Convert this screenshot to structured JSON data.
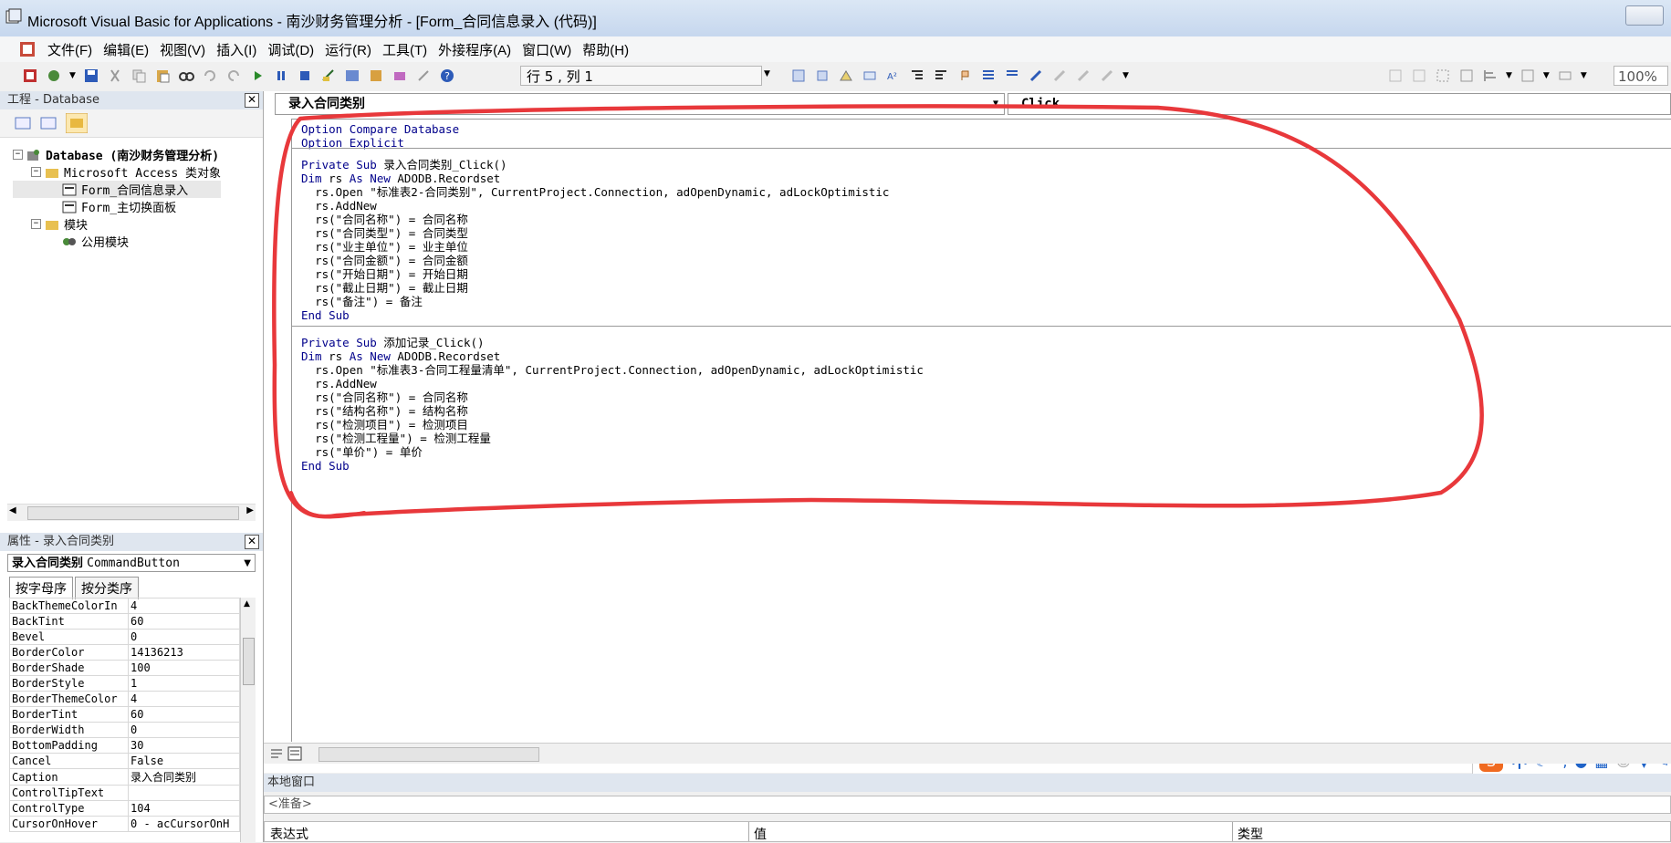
{
  "window": {
    "title": "Microsoft Visual Basic for Applications - 南沙财务管理分析 - [Form_合同信息录入 (代码)]"
  },
  "menu": [
    {
      "label": "文件(F)"
    },
    {
      "label": "编辑(E)"
    },
    {
      "label": "视图(V)"
    },
    {
      "label": "插入(I)"
    },
    {
      "label": "调试(D)"
    },
    {
      "label": "运行(R)"
    },
    {
      "label": "工具(T)"
    },
    {
      "label": "外接程序(A)"
    },
    {
      "label": "窗口(W)"
    },
    {
      "label": "帮助(H)"
    }
  ],
  "toolbar": {
    "cursor_position": "行 5 , 列 1",
    "zoom": "100%"
  },
  "project_pane": {
    "title": "工程 - Database",
    "close": "✕",
    "tree": {
      "root": "Database (南沙财务管理分析)",
      "group1": "Microsoft Access 类对象",
      "item1": "Form_合同信息录入",
      "item2": "Form_主切换面板",
      "group2": "模块",
      "item3": "公用模块"
    }
  },
  "properties_pane": {
    "title": "属性 - 录入合同类别",
    "close": "✕",
    "object_name": "录入合同类别",
    "object_type": "CommandButton",
    "tabs": [
      "按字母序",
      "按分类序"
    ],
    "rows": [
      {
        "name": "BackThemeColorIn",
        "value": "4"
      },
      {
        "name": "BackTint",
        "value": "60"
      },
      {
        "name": "Bevel",
        "value": "0"
      },
      {
        "name": "BorderColor",
        "value": "14136213"
      },
      {
        "name": "BorderShade",
        "value": "100"
      },
      {
        "name": "BorderStyle",
        "value": "1"
      },
      {
        "name": "BorderThemeColor",
        "value": "4"
      },
      {
        "name": "BorderTint",
        "value": "60"
      },
      {
        "name": "BorderWidth",
        "value": "0"
      },
      {
        "name": "BottomPadding",
        "value": "30"
      },
      {
        "name": "Cancel",
        "value": "False"
      },
      {
        "name": "Caption",
        "value": "录入合同类别"
      },
      {
        "name": "ControlTipText",
        "value": ""
      },
      {
        "name": "ControlType",
        "value": "104"
      },
      {
        "name": "CursorOnHover",
        "value": "0 - acCursorOnH"
      }
    ]
  },
  "code_window": {
    "object_combo": "录入合同类别",
    "proc_combo": "Click",
    "header_lines": [
      "Option Compare Database",
      "Option Explicit"
    ],
    "block1": [
      "Private Sub 录入合同类别_Click()",
      "Dim rs As New ADODB.Recordset",
      "  rs.Open \"标准表2-合同类别\", CurrentProject.Connection, adOpenDynamic, adLockOptimistic",
      "  rs.AddNew",
      "  rs(\"合同名称\") = 合同名称",
      "  rs(\"合同类型\") = 合同类型",
      "  rs(\"业主单位\") = 业主单位",
      "  rs(\"合同金额\") = 合同金额",
      "  rs(\"开始日期\") = 开始日期",
      "  rs(\"截止日期\") = 截止日期",
      "  rs(\"备注\") = 备注",
      "End Sub"
    ],
    "block2": [
      "Private Sub 添加记录_Click()",
      "Dim rs As New ADODB.Recordset",
      "  rs.Open \"标准表3-合同工程量清单\", CurrentProject.Connection, adOpenDynamic, adLockOptimistic",
      "  rs.AddNew",
      "  rs(\"合同名称\") = 合同名称",
      "  rs(\"结构名称\") = 结构名称",
      "  rs(\"检测项目\") = 检测项目",
      "  rs(\"检测工程量\") = 检测工程量",
      "  rs(\"单价\") = 单价",
      "End Sub"
    ]
  },
  "ime_toolbar": {
    "mode": "中"
  },
  "locals_window": {
    "title": "本地窗口",
    "status": "<准备>",
    "columns": [
      "表达式",
      "值",
      "类型"
    ]
  },
  "colors": {
    "annotation": "#e8383b",
    "keyword": "#00008b"
  }
}
